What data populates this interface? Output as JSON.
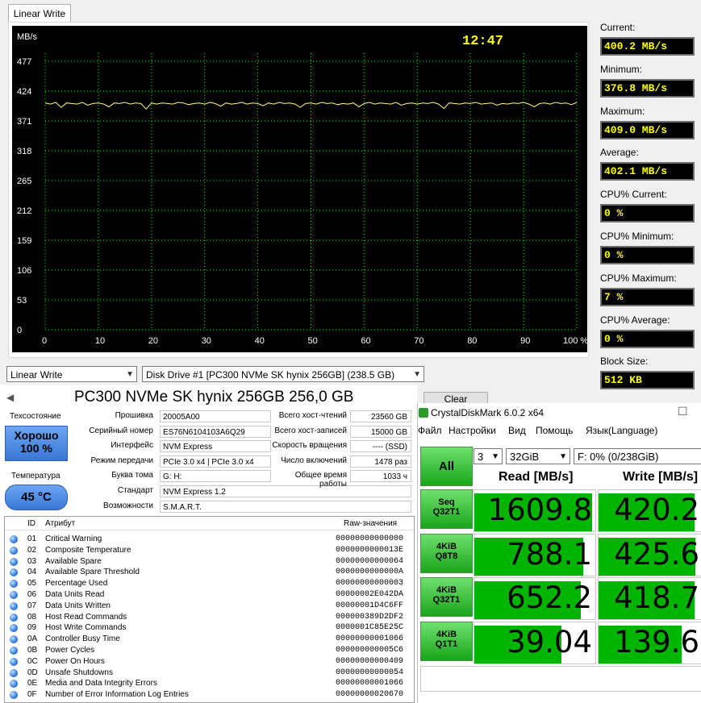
{
  "lw": {
    "tab": "Linear Write",
    "unit": "MB/s",
    "clock": "12:47",
    "y_ticks": [
      "477",
      "424",
      "371",
      "318",
      "265",
      "212",
      "159",
      "106",
      "53",
      "0"
    ],
    "x_ticks": [
      "0",
      "10",
      "20",
      "30",
      "40",
      "50",
      "60",
      "70",
      "80",
      "90",
      "100 %"
    ],
    "stats": [
      {
        "label": "Current:",
        "value": "400.2 MB/s"
      },
      {
        "label": "Minimum:",
        "value": "376.8 MB/s"
      },
      {
        "label": "Maximum:",
        "value": "409.0 MB/s"
      },
      {
        "label": "Average:",
        "value": "402.1 MB/s"
      },
      {
        "label": "CPU% Current:",
        "value": "0 %"
      },
      {
        "label": "CPU% Minimum:",
        "value": "0 %"
      },
      {
        "label": "CPU% Maximum:",
        "value": "7 %"
      },
      {
        "label": "CPU% Average:",
        "value": "0 %"
      },
      {
        "label": "Block Size:",
        "value": "512 KB"
      }
    ],
    "mode_select": "Linear Write",
    "drive_select": "Disk Drive #1  [PC300 NVMe SK hynix 256GB]  (238.5 GB)",
    "clear_button": "Clear"
  },
  "chart_data": {
    "type": "line",
    "ylabel": "MB/s",
    "ylim": [
      0,
      477
    ],
    "xlim": [
      0,
      100
    ],
    "series": [
      {
        "values": [
          403,
          401,
          404,
          395,
          403,
          402,
          401,
          404,
          399,
          402,
          403,
          401,
          396,
          403,
          402,
          404,
          401,
          403,
          402,
          392,
          403,
          401,
          403,
          402,
          401,
          404,
          403,
          400,
          402,
          403,
          401,
          404,
          402,
          397,
          403,
          401,
          402,
          404,
          401,
          403,
          402,
          398,
          403,
          401,
          404,
          402,
          403,
          401,
          395,
          402,
          403,
          401,
          404,
          402,
          403,
          400,
          402,
          401,
          403,
          396,
          402,
          404,
          401,
          403,
          402,
          401,
          404,
          399,
          402,
          403,
          401,
          403,
          402,
          404,
          401,
          393,
          403,
          402,
          401,
          403,
          402,
          404,
          401,
          402,
          403,
          399,
          402,
          401,
          403,
          402,
          404,
          401,
          396,
          402,
          403,
          401,
          404,
          402,
          403,
          400,
          404
        ]
      }
    ]
  },
  "di": {
    "title": "PC300 NVMe SK hynix 256GB 256,0 GB",
    "health_label": "Техсостояние",
    "health_value": "Хорошо",
    "health_pct": "100 %",
    "temp_label": "Температура",
    "temp_value": "45 °C",
    "fields_left": [
      {
        "label": "Прошивка",
        "value": "20005A00"
      },
      {
        "label": "Серийный номер",
        "value": "ES76N6104103A6Q29"
      },
      {
        "label": "Интерфейс",
        "value": "NVM Express"
      },
      {
        "label": "Режим передачи",
        "value": "PCIe 3.0 x4 | PCIe 3.0 x4"
      },
      {
        "label": "Буква тома",
        "value": "G: H:"
      },
      {
        "label": "Стандарт",
        "value": "NVM Express 1.2"
      },
      {
        "label": "Возможности",
        "value": "S.M.A.R.T."
      }
    ],
    "fields_right": [
      {
        "label": "Всего хост-чтений",
        "value": "23560 GB"
      },
      {
        "label": "Всего хост-записей",
        "value": "15000 GB"
      },
      {
        "label": "Скорость вращения",
        "value": "---- (SSD)"
      },
      {
        "label": "Число включений",
        "value": "1478 раз"
      },
      {
        "label": "Общее время работы",
        "value": "1033 ч"
      }
    ],
    "attr_headers": {
      "id": "ID",
      "name": "Атрибут",
      "raw": "Raw-значения"
    },
    "attrs": [
      {
        "id": "01",
        "name": "Critical Warning",
        "raw": "00000000000000"
      },
      {
        "id": "02",
        "name": "Composite Temperature",
        "raw": "0000000000013E"
      },
      {
        "id": "03",
        "name": "Available Spare",
        "raw": "00000000000064"
      },
      {
        "id": "04",
        "name": "Available Spare Threshold",
        "raw": "0000000000000A"
      },
      {
        "id": "05",
        "name": "Percentage Used",
        "raw": "00000000000003"
      },
      {
        "id": "06",
        "name": "Data Units Read",
        "raw": "00000002E042DA"
      },
      {
        "id": "07",
        "name": "Data Units Written",
        "raw": "00000001D4C6FF"
      },
      {
        "id": "08",
        "name": "Host Read Commands",
        "raw": "000000389D2DF2"
      },
      {
        "id": "09",
        "name": "Host Write Commands",
        "raw": "0000001C85E25C"
      },
      {
        "id": "0A",
        "name": "Controller Busy Time",
        "raw": "00000000001066"
      },
      {
        "id": "0B",
        "name": "Power Cycles",
        "raw": "000000000005C6"
      },
      {
        "id": "0C",
        "name": "Power On Hours",
        "raw": "00000000000409"
      },
      {
        "id": "0D",
        "name": "Unsafe Shutdowns",
        "raw": "00000000000054"
      },
      {
        "id": "0E",
        "name": "Media and Data Integrity Errors",
        "raw": "00000000001066"
      },
      {
        "id": "0F",
        "name": "Number of Error Information Log Entries",
        "raw": "00000000020670"
      }
    ]
  },
  "cdm": {
    "title": "CrystalDiskMark 6.0.2 x64",
    "menu": [
      "Файл",
      "Настройки",
      "Вид",
      "Помощь",
      "Язык(Language)"
    ],
    "all_button": "All",
    "count": "3",
    "size": "32GiB",
    "drive": "F: 0% (0/238GiB)",
    "read_header": "Read [MB/s]",
    "write_header": "Write [MB/s]",
    "rows": [
      {
        "btn1": "Seq",
        "btn2": "Q32T1",
        "read": "1609.8",
        "write": "420.2",
        "read_frac": 0.97,
        "write_frac": 0.92
      },
      {
        "btn1": "4KiB",
        "btn2": "Q8T8",
        "read": "788.1",
        "write": "425.6",
        "read_frac": 0.9,
        "write_frac": 0.93
      },
      {
        "btn1": "4KiB",
        "btn2": "Q32T1",
        "read": "652.2",
        "write": "418.7",
        "read_frac": 0.88,
        "write_frac": 0.92
      },
      {
        "btn1": "4KiB",
        "btn2": "Q1T1",
        "read": "39.04",
        "write": "139.6",
        "read_frac": 0.72,
        "write_frac": 0.8
      }
    ]
  }
}
